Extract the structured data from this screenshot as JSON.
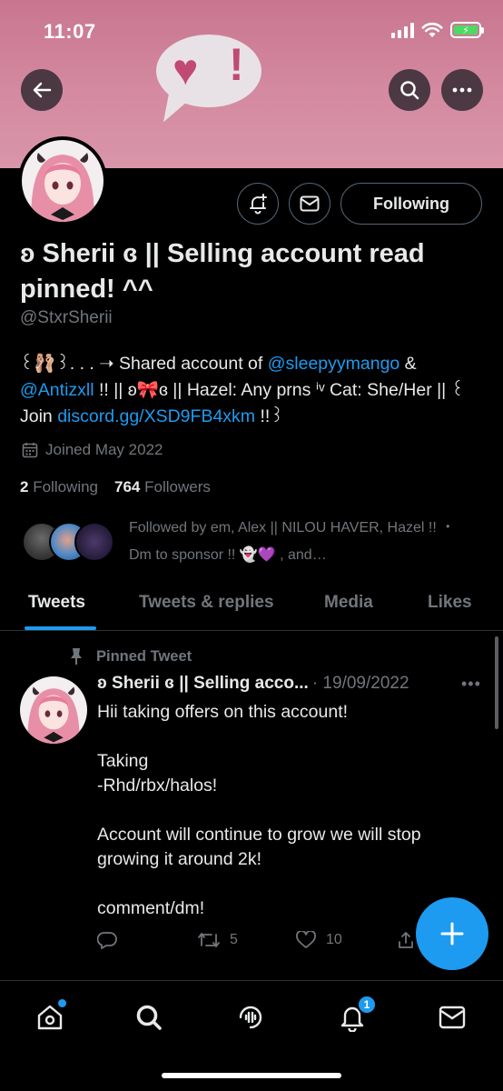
{
  "status_bar": {
    "time": "11:07"
  },
  "profile": {
    "display_name": "ʚ Sherii ɞ || Selling account read pinned! ^^",
    "handle": "@StxrSherii",
    "bio": {
      "p1": "꒰🩰꒱. . . ➝ Shared account of ",
      "m1": "@sleepyymango",
      "p2": " & ",
      "m2": "@Antizxll",
      "p3": " !! || ʚ🎀ɞ || Hazel: Any prns ⁱᵛ Cat: She/Her || ꒰Join ",
      "link": "discord.gg/XSD9FB4xkm",
      "p4": " !!꒱"
    },
    "joined": "Joined May 2022",
    "following_count": "2",
    "following_label": "Following",
    "followers_count": "764",
    "followers_label": "Followers",
    "followed_by": "Followed by em, Alex || NILOU HAVER, Hazel !! ・ Dm to sponsor !! 👻💜 , and…",
    "following_button": "Following"
  },
  "tabs": [
    {
      "label": "Tweets",
      "active": true
    },
    {
      "label": "Tweets & replies",
      "active": false
    },
    {
      "label": "Media",
      "active": false
    },
    {
      "label": "Likes",
      "active": false
    }
  ],
  "tweet": {
    "pinned_label": "Pinned Tweet",
    "author": "ʚ Sherii ɞ || Selling acco...",
    "date": "· 19/09/2022",
    "text": "Hii taking offers on this account!\n\nTaking\n-Rhd/rbx/halos!\n\nAccount will continue to grow we will stop growing it around 2k!\n\ncomment/dm!",
    "retweets": "5",
    "likes": "10"
  },
  "bottom_nav": {
    "notifications_badge": "1"
  },
  "colors": {
    "accent": "#1d9bf0",
    "banner": "#d48aa1",
    "muted": "#71767b"
  }
}
